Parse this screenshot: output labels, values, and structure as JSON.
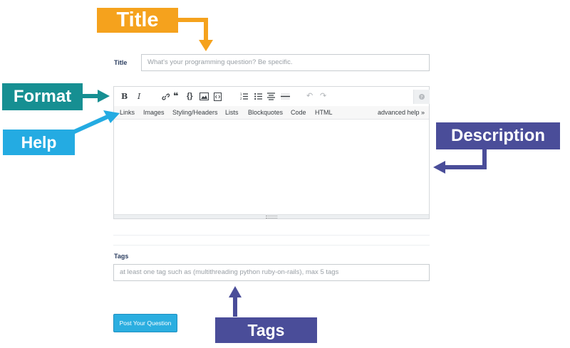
{
  "form": {
    "title_label": "Title",
    "title_placeholder": "What's your programming question? Be specific.",
    "toolbar": {
      "bold": "B",
      "italic": "I",
      "link_icon": "link-icon",
      "quote_icon": "blockquote-icon",
      "code": "{}",
      "image_icon": "image-icon",
      "snippet_icon": "snippet-icon",
      "ol_icon": "ordered-list-icon",
      "ul_icon": "unordered-list-icon",
      "heading_icon": "heading-icon",
      "hr_icon": "horizontal-rule-icon",
      "undo": "↶",
      "redo": "↷",
      "help_icon": "help-icon"
    },
    "help_links": [
      "Links",
      "Images",
      "Styling/Headers",
      "Lists",
      "Blockquotes",
      "Code",
      "HTML"
    ],
    "advanced_help": "advanced help »",
    "tags_label": "Tags",
    "tags_placeholder": "at least one tag such as (multithreading python ruby-on-rails), max 5 tags",
    "submit_label": "Post Your Question"
  },
  "annotations": {
    "title": "Title",
    "format": "Format",
    "help": "Help",
    "description": "Description",
    "tags": "Tags"
  },
  "colors": {
    "orange": "#f5a21d",
    "teal": "#168f92",
    "sky": "#24abe2",
    "navy": "#4a4d99",
    "button": "#2baee0"
  }
}
